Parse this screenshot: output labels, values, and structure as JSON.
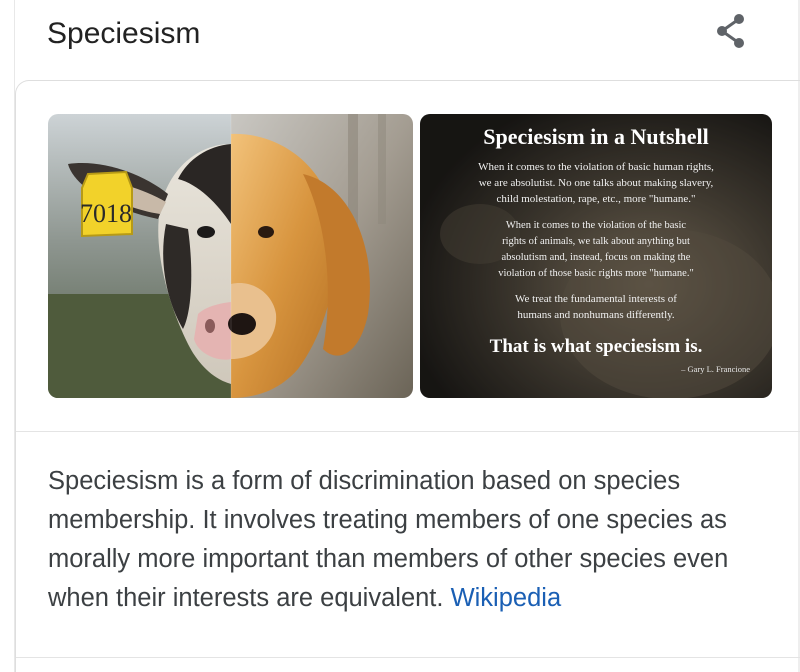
{
  "header": {
    "title": "Speciesism",
    "share_icon": "share-icon"
  },
  "images": {
    "left": {
      "subject": "cow-and-dog-split-face",
      "ear_tag": "7018"
    },
    "right": {
      "heading": "Speciesism in a Nutshell",
      "paragraph_1": [
        "When it comes to the violation of basic human rights,",
        "we are absolutist. No one talks about making slavery,",
        "child molestation, rape, etc., more \"humane.\""
      ],
      "paragraph_2": [
        "When it comes to the violation of the basic",
        "rights of animals, we talk about anything but",
        "absolutism and, instead, focus on making the",
        "violation of those basic rights more \"humane.\""
      ],
      "paragraph_3": [
        "We treat the fundamental interests of",
        "humans and nonhumans differently."
      ],
      "tagline": "That is what speciesism is.",
      "attribution": "– Gary L. Francione"
    }
  },
  "description": {
    "text": "Speciesism is a form of discrimination based on species membership. It involves treating members of one species as morally more important than members of other species even when their interests are equivalent.",
    "link_label": "Wikipedia"
  },
  "colors": {
    "link": "#1a5fb4",
    "text": "#3c4043",
    "title": "#222222"
  }
}
